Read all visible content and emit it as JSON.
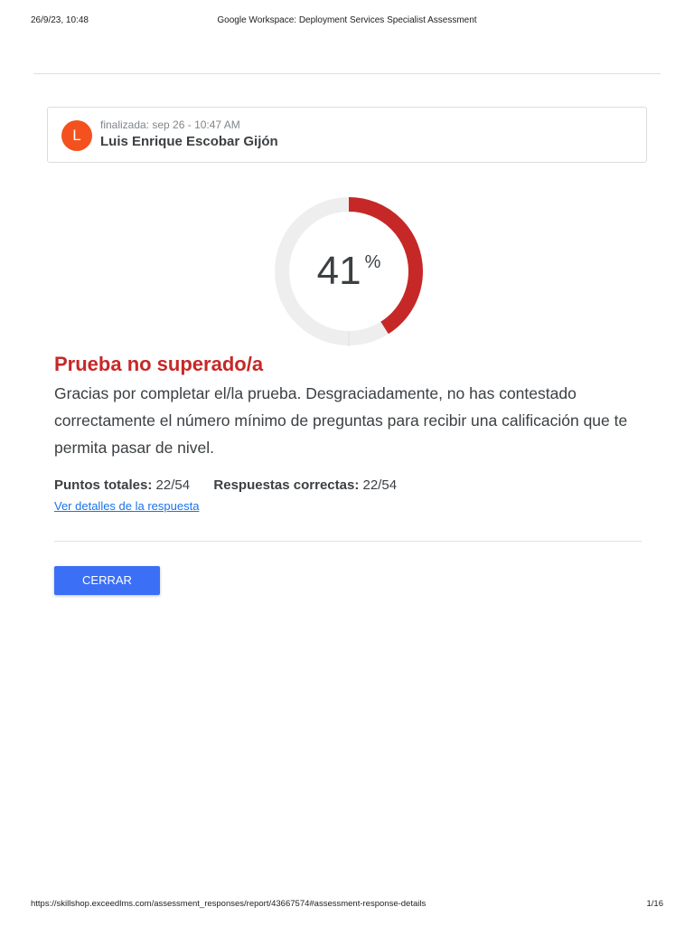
{
  "print_header": {
    "date": "26/9/23, 10:48",
    "title": "Google Workspace: Deployment Services Specialist Assessment"
  },
  "user_card": {
    "avatar_letter": "L",
    "avatar_color": "#f4511e",
    "finished_label": "finalizada: sep 26 - 10:47 AM",
    "name": "Luis Enrique Escobar Gijón"
  },
  "score": {
    "value": "41",
    "percent_sign": "%",
    "fraction": 0.41,
    "ring_color": "#c62828",
    "track_color": "#eeeeee"
  },
  "result": {
    "title": "Prueba no superado/a",
    "title_color": "#c62828",
    "message": "Gracias por completar el/la prueba. Desgraciadamente, no has contestado correctamente el número mínimo de preguntas para recibir una calificación que te permita pasar de nivel."
  },
  "stats": {
    "total_points_label": "Puntos totales:",
    "total_points_value": "22/54",
    "correct_answers_label": "Respuestas correctas:",
    "correct_answers_value": "22/54"
  },
  "details_link": "Ver detalles de la respuesta",
  "close_button": {
    "label": "CERRAR",
    "color": "#3b6ff5"
  },
  "print_footer": {
    "url": "https://skillshop.exceedlms.com/assessment_responses/report/43667574#assessment-response-details",
    "page": "1/16"
  }
}
